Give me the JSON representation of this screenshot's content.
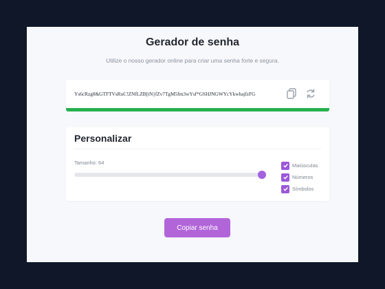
{
  "header": {
    "title": "Gerador de senha",
    "subtitle": "Utilize o nosso gerador online para criar uma senha forte e segura."
  },
  "password": {
    "value": "Ys6cRzg8&GTFTVsRuC!ZNfLZB[tN}fZv7TgM5fm3wYsf*GSHJNGWYcYkwhajfzFG",
    "copy_icon": "copy-icon",
    "refresh_icon": "refresh-icon",
    "strength_fraction": 1.0,
    "strength_color": "#26b04f"
  },
  "settings": {
    "title": "Personalizar",
    "length_label": "Tamanho: 64",
    "length_slider_fraction": 1.0,
    "options": [
      {
        "label": "Maiúsculas",
        "checked": true
      },
      {
        "label": "Números",
        "checked": true
      },
      {
        "label": "Símbolos",
        "checked": true
      }
    ]
  },
  "actions": {
    "copy_label": "Copiar senha"
  },
  "colors": {
    "background": "#0f1729",
    "accent": "#b265d9",
    "checkbox": "#9b58d8"
  }
}
